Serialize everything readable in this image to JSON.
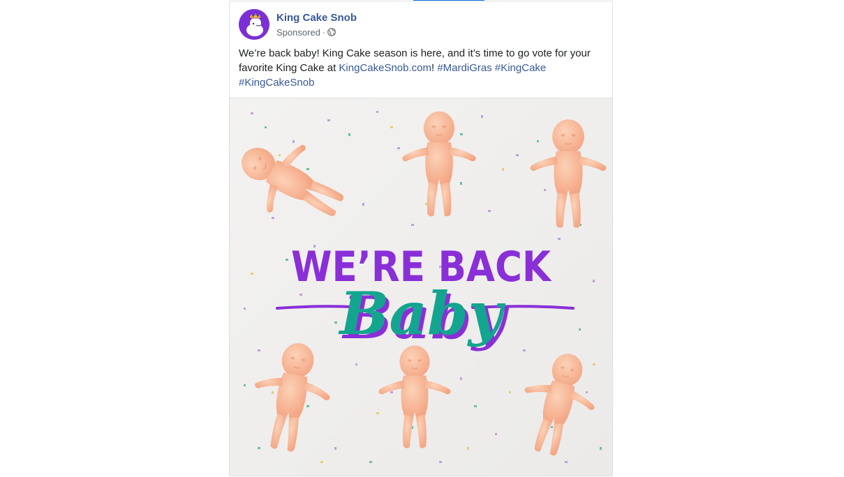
{
  "post": {
    "page_name": "King Cake Snob",
    "sponsored": "Sponsored",
    "separator": "·",
    "icon": "globe-icon",
    "caption": {
      "text_1": "We’re back baby! King Cake season is here, and it’s time to go vote for your favorite King Cake at ",
      "link": "KingCakeSnob.com",
      "text_2": "! ",
      "hashtags": [
        "#MardiGras",
        "#KingCake",
        "#KingCakeSnob"
      ]
    }
  },
  "image": {
    "headline_1": "WE’RE BACK",
    "headline_2": "Baby",
    "colors": {
      "purple": "#8a2fd8",
      "teal": "#13a58f",
      "baby": "#f6b08f",
      "background": "#f1f0ef"
    }
  },
  "colors": {
    "link": "#385898",
    "text": "#1c1e21",
    "meta": "#606770",
    "avatar": "#7b2fd6"
  }
}
